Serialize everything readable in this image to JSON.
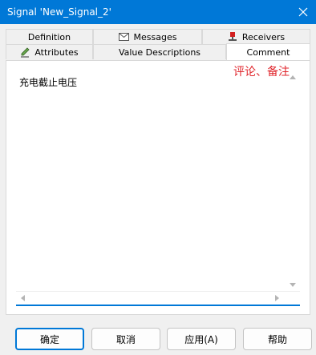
{
  "window": {
    "title": "Signal 'New_Signal_2'"
  },
  "tabs_row_back": [
    {
      "label": "Definition",
      "icon": null
    },
    {
      "label": "Messages",
      "icon": "envelope-icon"
    },
    {
      "label": "Receivers",
      "icon": "receiver-pin-icon"
    }
  ],
  "tabs_row_front": [
    {
      "label": "Attributes",
      "icon": "pencil-icon"
    },
    {
      "label": "Value Descriptions",
      "icon": null
    },
    {
      "label": "Comment",
      "icon": null,
      "selected": true
    }
  ],
  "annotation": {
    "text": "评论、备注",
    "color": "#e0262c"
  },
  "comment": {
    "value": "充电截止电压"
  },
  "buttons": {
    "ok": "确定",
    "cancel": "取消",
    "apply": "应用(A)",
    "help": "帮助"
  },
  "colors": {
    "accent": "#0078d7",
    "tab_border": "#d9d9d9",
    "background": "#f0f0f0"
  }
}
